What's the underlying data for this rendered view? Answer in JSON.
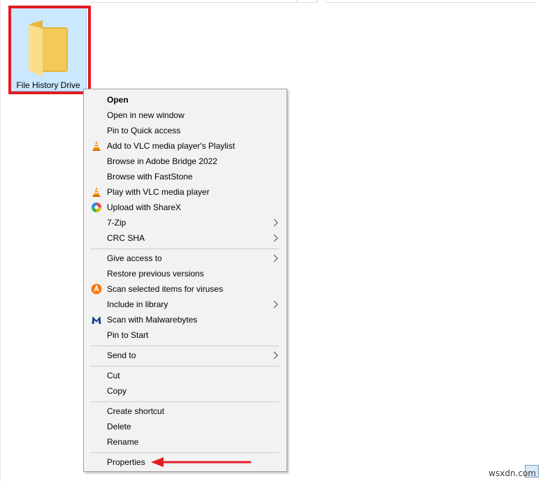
{
  "folder": {
    "label": "File History Drive"
  },
  "menu": {
    "items": [
      {
        "label": "Open",
        "bold": true,
        "icon": "",
        "submenu": false
      },
      {
        "label": "Open in new window",
        "icon": "",
        "submenu": false
      },
      {
        "label": "Pin to Quick access",
        "icon": "",
        "submenu": false
      },
      {
        "label": "Add to VLC media player's Playlist",
        "icon": "vlc-cone-icon",
        "submenu": false
      },
      {
        "label": "Browse in Adobe Bridge 2022",
        "icon": "",
        "submenu": false
      },
      {
        "label": "Browse with FastStone",
        "icon": "",
        "submenu": false
      },
      {
        "label": "Play with VLC media player",
        "icon": "vlc-cone-icon",
        "submenu": false
      },
      {
        "label": "Upload with ShareX",
        "icon": "sharex-icon",
        "submenu": false
      },
      {
        "label": "7-Zip",
        "icon": "",
        "submenu": true
      },
      {
        "label": "CRC SHA",
        "icon": "",
        "submenu": true
      },
      {
        "label": "Give access to",
        "icon": "",
        "submenu": true
      },
      {
        "label": "Restore previous versions",
        "icon": "",
        "submenu": false
      },
      {
        "label": "Scan selected items for viruses",
        "icon": "avast-icon",
        "submenu": false
      },
      {
        "label": "Include in library",
        "icon": "",
        "submenu": true
      },
      {
        "label": "Scan with Malwarebytes",
        "icon": "malwarebytes-icon",
        "submenu": false
      },
      {
        "label": "Pin to Start",
        "icon": "",
        "submenu": false
      },
      {
        "label": "Send to",
        "icon": "",
        "submenu": true
      },
      {
        "label": "Cut",
        "icon": "",
        "submenu": false
      },
      {
        "label": "Copy",
        "icon": "",
        "submenu": false
      },
      {
        "label": "Create shortcut",
        "icon": "",
        "submenu": false
      },
      {
        "label": "Delete",
        "icon": "",
        "submenu": false
      },
      {
        "label": "Rename",
        "icon": "",
        "submenu": false
      },
      {
        "label": "Properties",
        "icon": "",
        "submenu": false
      }
    ]
  },
  "colors": {
    "highlight_border": "#e31b23",
    "annotation_arrow": "#e31b23",
    "selection_fill": "#cce8ff",
    "menu_background": "#f2f2f2"
  },
  "watermark": {
    "text": "wsxdn.com"
  }
}
